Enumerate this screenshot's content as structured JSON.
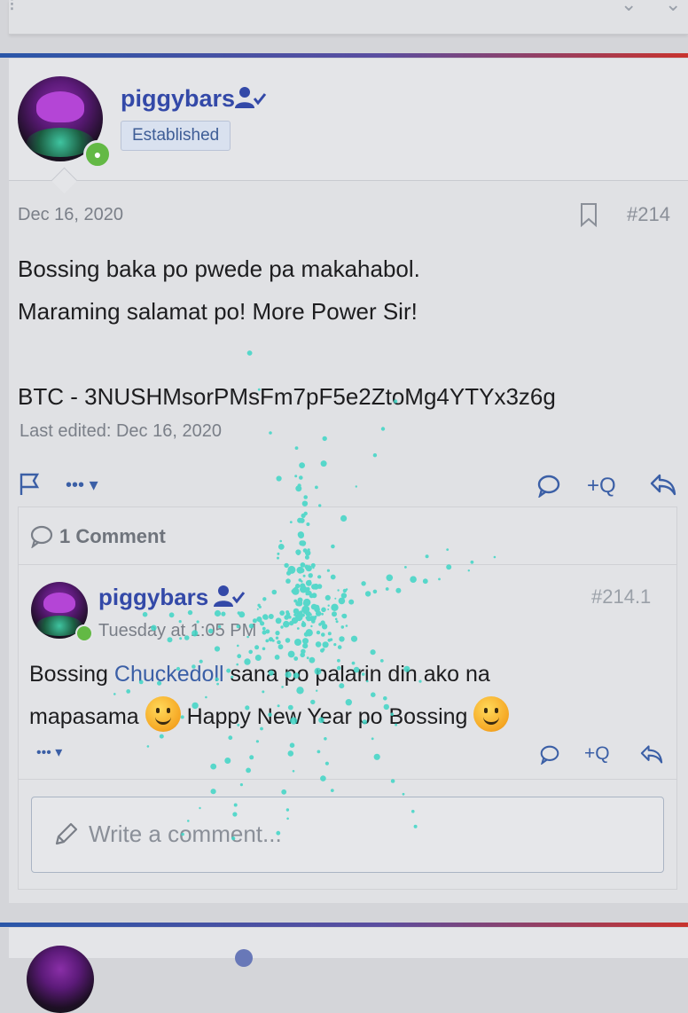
{
  "post": {
    "author": "piggybars",
    "user_title": "Established",
    "date": "Dec 16, 2020",
    "number": "#214",
    "lines": [
      "Bossing baka po pwede pa makahabol.",
      "Maraming salamat po! More Power Sir!",
      "",
      "BTC - 3NUSHMsorPMsFm7pF5e2ZtoMg4YTYx3z6g"
    ],
    "last_edited": "Last edited: Dec 16, 2020",
    "more_label": "•••",
    "quote_label": "+Q"
  },
  "comments": {
    "count_label": "1 Comment",
    "items": [
      {
        "author": "piggybars",
        "date": "Tuesday at 1:05 PM",
        "number": "#214.1",
        "text_before_link": "Bossing ",
        "link": "Chuckedoll",
        "text_after_link": " sana po palarin din ako na",
        "line2_start": "mapasama ",
        "line2_mid": " Happy New Year po Bossing ",
        "more_label": "•••",
        "quote_label": "+Q"
      }
    ],
    "reply_placeholder": "Write a comment..."
  },
  "colors": {
    "accent": "#3b5fa6",
    "username": "#3349a8",
    "online": "#63b945"
  }
}
